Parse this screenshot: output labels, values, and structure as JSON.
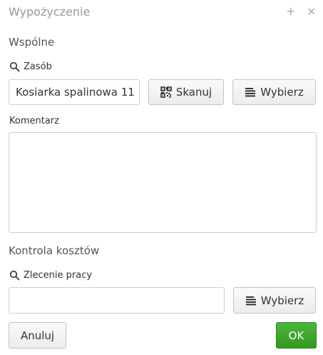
{
  "window": {
    "title": "Wypożyczenie",
    "plus_glyph": "+",
    "close_glyph": "×"
  },
  "common": {
    "section_title": "Wspólne",
    "resource_label": "Zasób",
    "resource_value": "Kosiarka spalinowa 11",
    "scan_label": "Skanuj",
    "choose_label": "Wybierz",
    "comment_label": "Komentarz",
    "comment_value": ""
  },
  "costs": {
    "section_title": "Kontrola kosztów",
    "work_order_label": "Zlecenie pracy",
    "work_order_value": "",
    "choose_label": "Wybierz"
  },
  "footer": {
    "cancel_label": "Anuluj",
    "ok_label": "OK"
  },
  "colors": {
    "ok_green": "#3aa12a",
    "muted_text": "#9a9a9a"
  },
  "icons": [
    "search-icon",
    "qr-code-icon",
    "list-icon"
  ]
}
